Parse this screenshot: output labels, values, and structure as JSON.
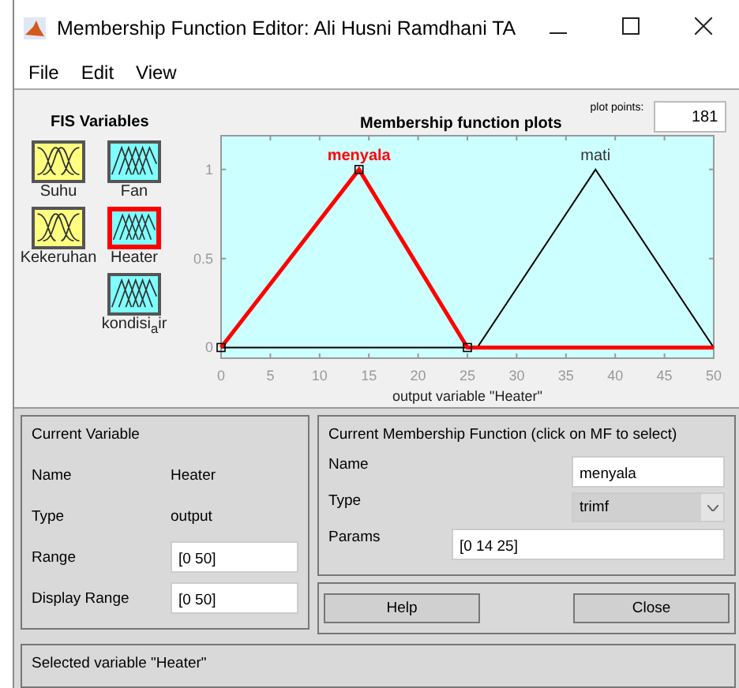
{
  "window": {
    "title": "Membership Function Editor: Ali Husni Ramdhani TA"
  },
  "menu": [
    "File",
    "Edit",
    "View"
  ],
  "fis_variables": {
    "title": "FIS Variables",
    "items": [
      {
        "label": "Suhu",
        "kind": "input",
        "selected": false
      },
      {
        "label": "Fan",
        "kind": "output",
        "selected": false
      },
      {
        "label": "Kekeruhan",
        "kind": "input",
        "selected": false
      },
      {
        "label": "Heater",
        "kind": "output",
        "selected": true
      },
      {
        "label": "kondisi$_{a}$ir",
        "kind": "output",
        "selected": false
      }
    ]
  },
  "plot": {
    "plot_points_label": "plot points:",
    "plot_points": "181",
    "chart_data": {
      "type": "line",
      "title": "Membership function plots",
      "xlabel": "output variable \"Heater\"",
      "x": [
        0,
        14,
        25,
        26,
        38,
        50
      ],
      "series": [
        {
          "name": "menyala",
          "color": "#ff0000",
          "values": [
            0,
            1,
            0,
            0,
            0,
            0
          ]
        },
        {
          "name": "mati",
          "color": "#000000",
          "values": [
            0,
            0,
            0,
            0,
            1,
            0
          ]
        }
      ],
      "xlim": [
        0,
        50
      ],
      "ylim": [
        -0.06,
        1.19
      ],
      "xticks": [
        0,
        5,
        10,
        15,
        20,
        25,
        30,
        35,
        40,
        45,
        50
      ],
      "yticks": [
        0,
        0.5,
        1
      ]
    },
    "curves": [
      {
        "selected": true
      },
      {
        "selected": false
      }
    ]
  },
  "current_variable": {
    "title": "Current Variable",
    "name_label": "Name",
    "name": "Heater",
    "type_label": "Type",
    "type": "output",
    "range_label": "Range",
    "range": "[0 50]",
    "display_range_label": "Display Range",
    "display_range": "[0 50]"
  },
  "current_mf": {
    "title": "Current Membership Function (click on MF to select)",
    "name_label": "Name",
    "name": "menyala",
    "type_label": "Type",
    "type": "trimf",
    "params_label": "Params",
    "params": "[0 14 25]"
  },
  "buttons": [
    "Help",
    "Close"
  ],
  "status": "Selected variable \"Heater\""
}
